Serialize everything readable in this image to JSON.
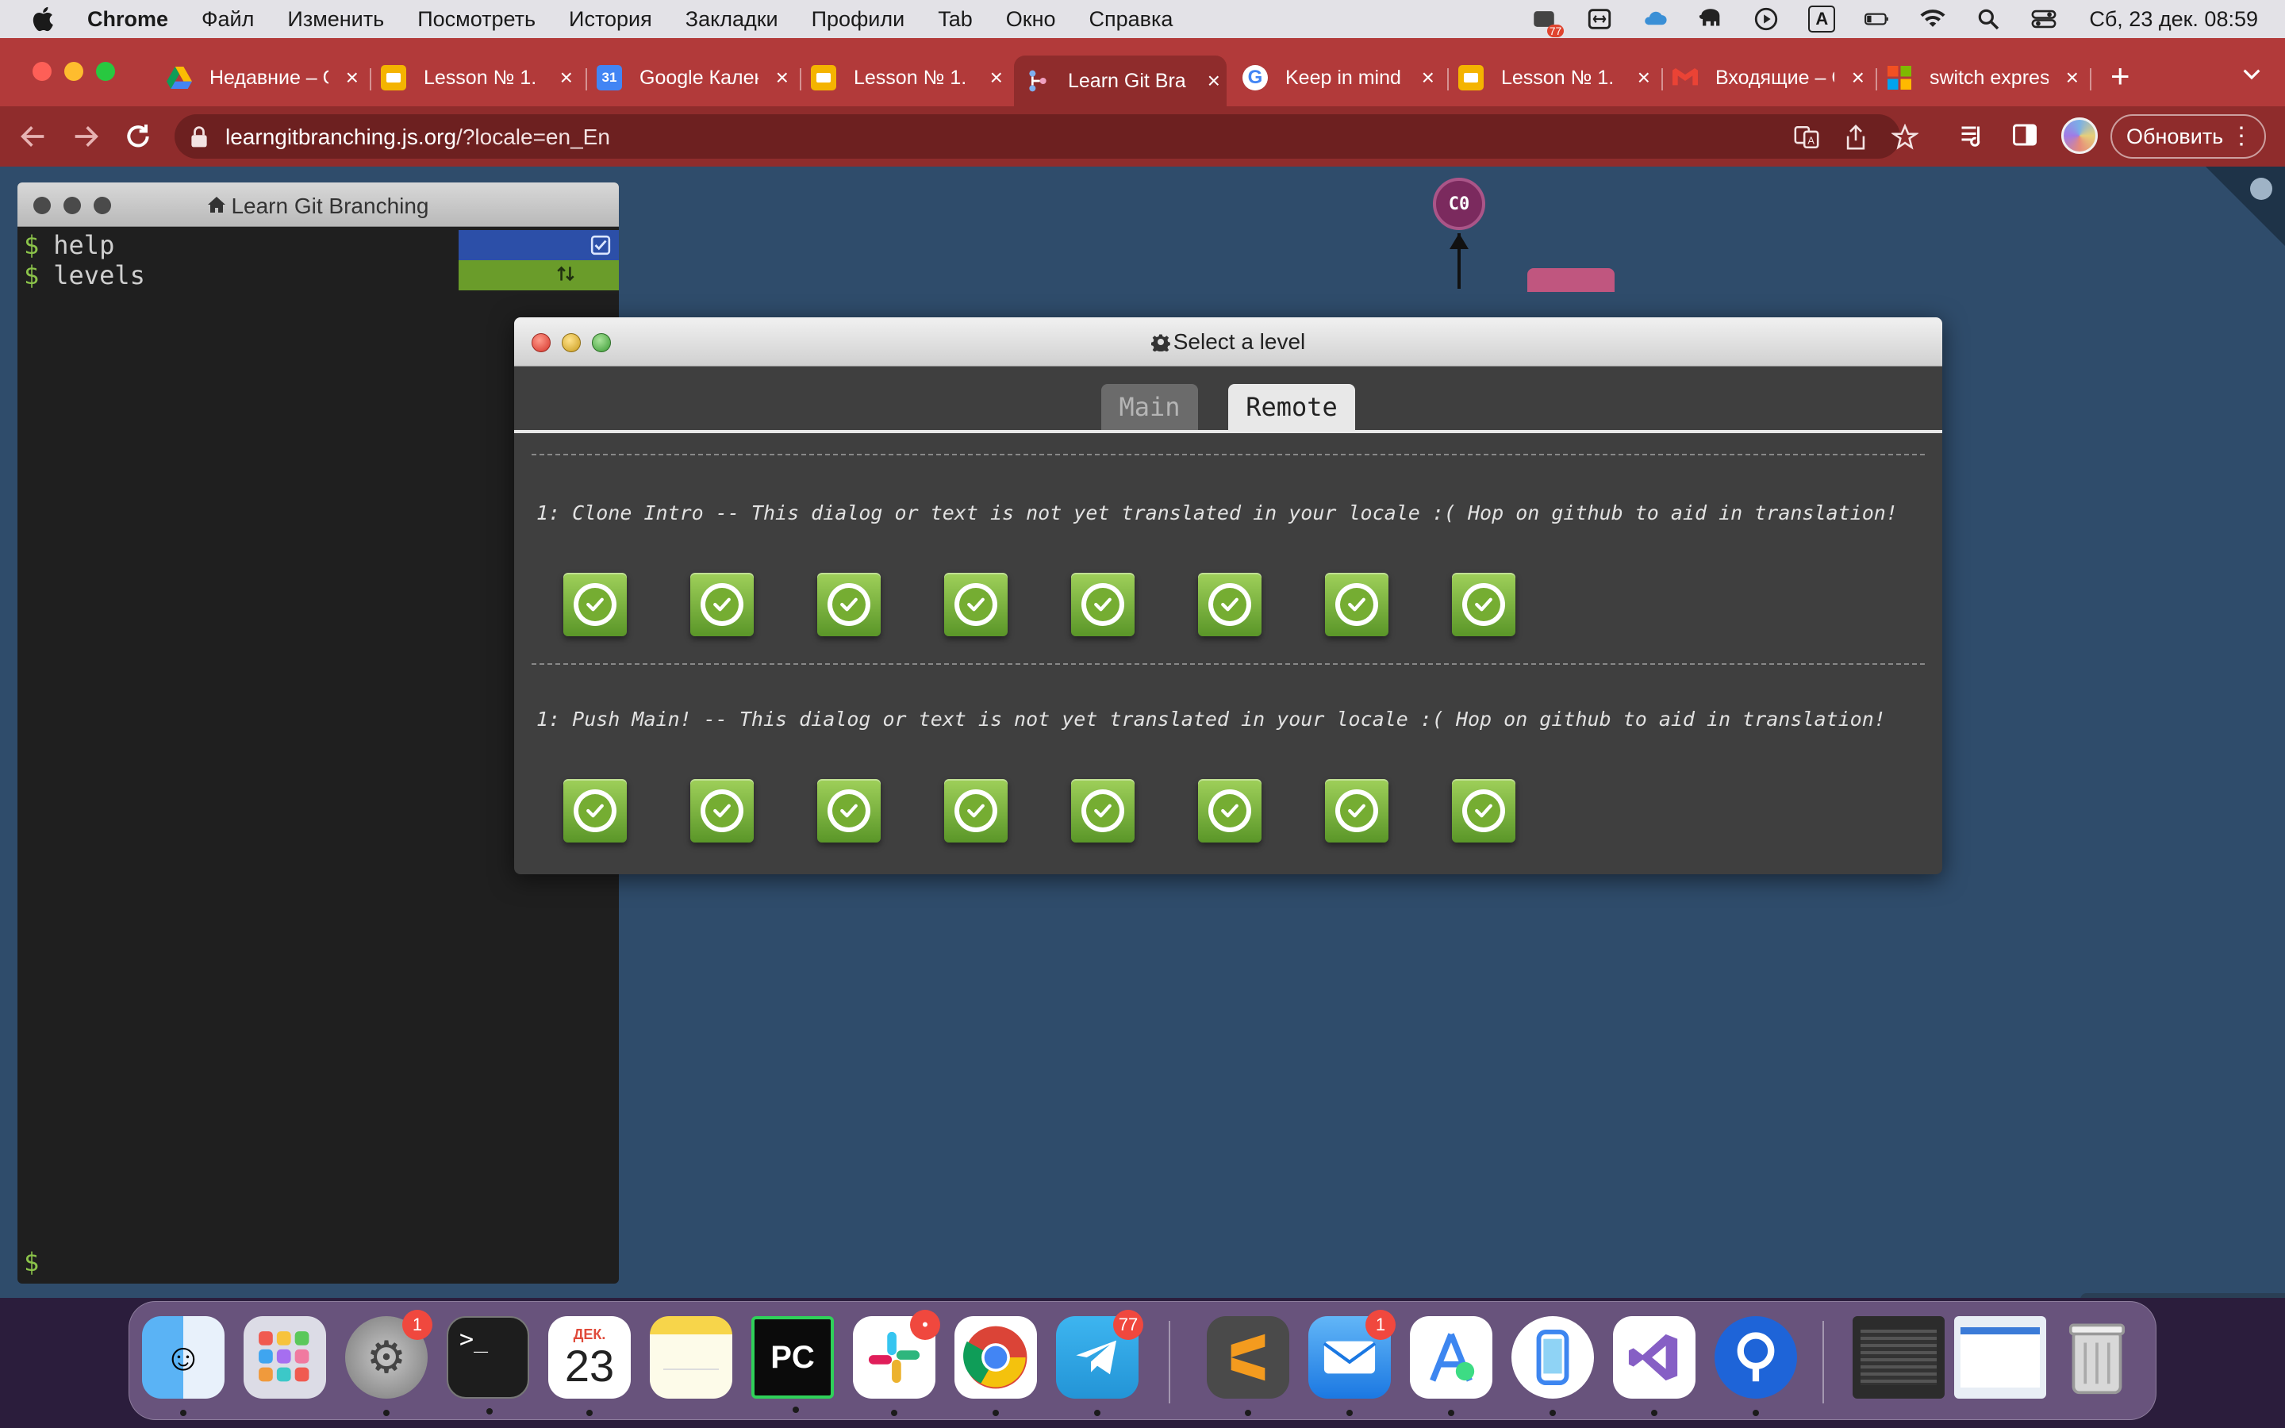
{
  "menubar": {
    "app_name": "Chrome",
    "items": [
      "Файл",
      "Изменить",
      "Посмотреть",
      "История",
      "Закладки",
      "Профили",
      "Tab",
      "Окно",
      "Справка"
    ],
    "notification_badge": "77",
    "clock": "Сб, 23 дек.  08:59",
    "keyboard_layout": "A"
  },
  "browser": {
    "tabs": [
      {
        "title": "Недавние – Google Диск",
        "favicon": "google-drive-icon",
        "color": "#4caf50"
      },
      {
        "title": "Lesson № 1.",
        "favicon": "google-slides-icon",
        "color": "#f4b400"
      },
      {
        "title": "Google Календарь",
        "favicon": "google-calendar-icon",
        "color": "#4285f4"
      },
      {
        "title": "Lesson № 1.",
        "favicon": "google-slides-icon",
        "color": "#f4b400"
      },
      {
        "title": "Learn Git Branching",
        "favicon": "git-branching-icon",
        "color": "#5b8bd6"
      },
      {
        "title": "Keep in mind",
        "favicon": "google-icon",
        "color": "#ffffff"
      },
      {
        "title": "Lesson № 1.",
        "favicon": "google-slides-icon",
        "color": "#f4b400"
      },
      {
        "title": "Входящие – Gmail",
        "favicon": "gmail-icon",
        "color": "#ffffff"
      },
      {
        "title": "switch expression",
        "favicon": "microsoft-icon",
        "color": "#ffffff"
      }
    ],
    "active_tab_index": 4,
    "url_host": "learngitbranching.js.org",
    "url_path": "/?locale=en_En",
    "update_button": "Обновить"
  },
  "terminal": {
    "title": "Learn Git Branching",
    "commands": [
      "help",
      "levels"
    ],
    "prompt": "$"
  },
  "graph": {
    "node_label": "C0"
  },
  "dialog": {
    "title": "Select a level",
    "tabs": [
      "Main",
      "Remote"
    ],
    "selected_tab": "Remote",
    "sequences": [
      {
        "title": "1: Clone Intro -- This dialog or text is not yet translated in your locale :( Hop on github to aid in translation!",
        "levels_completed": 8
      },
      {
        "title": "1: Push Main! -- This dialog or text is not yet translated in your locale :( Hop on github to aid in translation!",
        "levels_completed": 8
      }
    ]
  },
  "dock": {
    "apps": [
      {
        "name": "Finder",
        "icon": "finder-icon"
      },
      {
        "name": "Launchpad",
        "icon": "launchpad-icon"
      },
      {
        "name": "System Settings",
        "icon": "settings-icon",
        "badge": "1"
      },
      {
        "name": "Terminal",
        "icon": "terminal-icon"
      },
      {
        "name": "Calendar",
        "icon": "calendar-icon",
        "month": "ДЕК.",
        "day": "23"
      },
      {
        "name": "Notes",
        "icon": "notes-icon"
      },
      {
        "name": "PyCharm",
        "icon": "pycharm-icon",
        "label": "PC"
      },
      {
        "name": "Slack",
        "icon": "slack-icon",
        "badge": "•"
      },
      {
        "name": "Chrome",
        "icon": "chrome-icon"
      },
      {
        "name": "Telegram",
        "icon": "telegram-icon",
        "badge": "77"
      },
      {
        "name": "Sublime Text",
        "icon": "sublime-icon"
      },
      {
        "name": "Mail",
        "icon": "mail-icon",
        "badge": "1"
      },
      {
        "name": "Android Studio",
        "icon": "android-studio-icon"
      },
      {
        "name": "Simulator",
        "icon": "simulator-icon"
      },
      {
        "name": "Visual Studio",
        "icon": "visual-studio-icon"
      },
      {
        "name": "Proxyman",
        "icon": "proxyman-icon"
      }
    ]
  }
}
